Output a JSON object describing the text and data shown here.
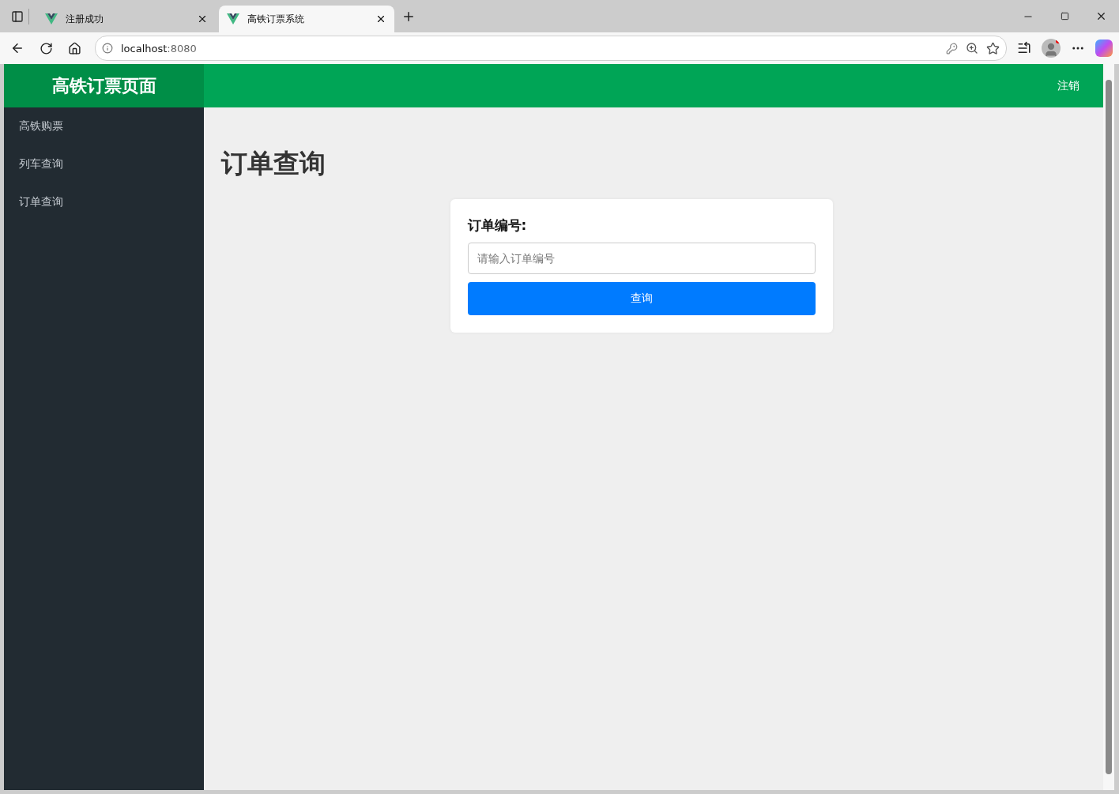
{
  "browser": {
    "tabs": [
      {
        "title": "注册成功",
        "selected": false
      },
      {
        "title": "高铁订票系统",
        "selected": true
      }
    ],
    "address": {
      "host": "localhost",
      "port": ":8080"
    }
  },
  "brand": "高铁订票页面",
  "logout": "注销",
  "sidebar": {
    "items": [
      {
        "label": "高铁购票"
      },
      {
        "label": "列车查询"
      },
      {
        "label": "订单查询"
      }
    ]
  },
  "page_title": "订单查询",
  "form": {
    "label": "订单编号:",
    "placeholder": "请输入订单编号",
    "button": "查询"
  }
}
